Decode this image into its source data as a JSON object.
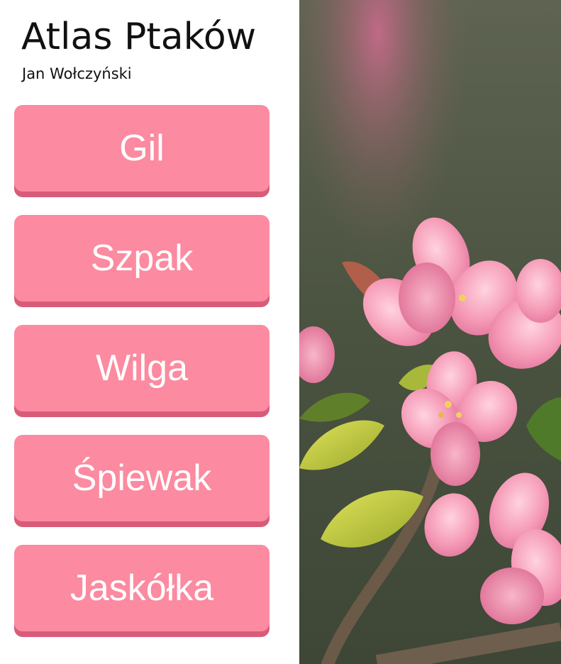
{
  "header": {
    "title": "Atlas Ptaków",
    "author": "Jan Wołczyński"
  },
  "menu": {
    "items": [
      {
        "label": "Gil"
      },
      {
        "label": "Szpak"
      },
      {
        "label": "Wilga"
      },
      {
        "label": "Śpiewak"
      },
      {
        "label": "Jaskółka"
      }
    ]
  },
  "colors": {
    "button": "#fc8aa0",
    "button_shadow": "#d85c7a",
    "button_text": "#ffffff",
    "photo_background": "#5b5b4a"
  },
  "image": {
    "icon": "blossom-photo"
  }
}
